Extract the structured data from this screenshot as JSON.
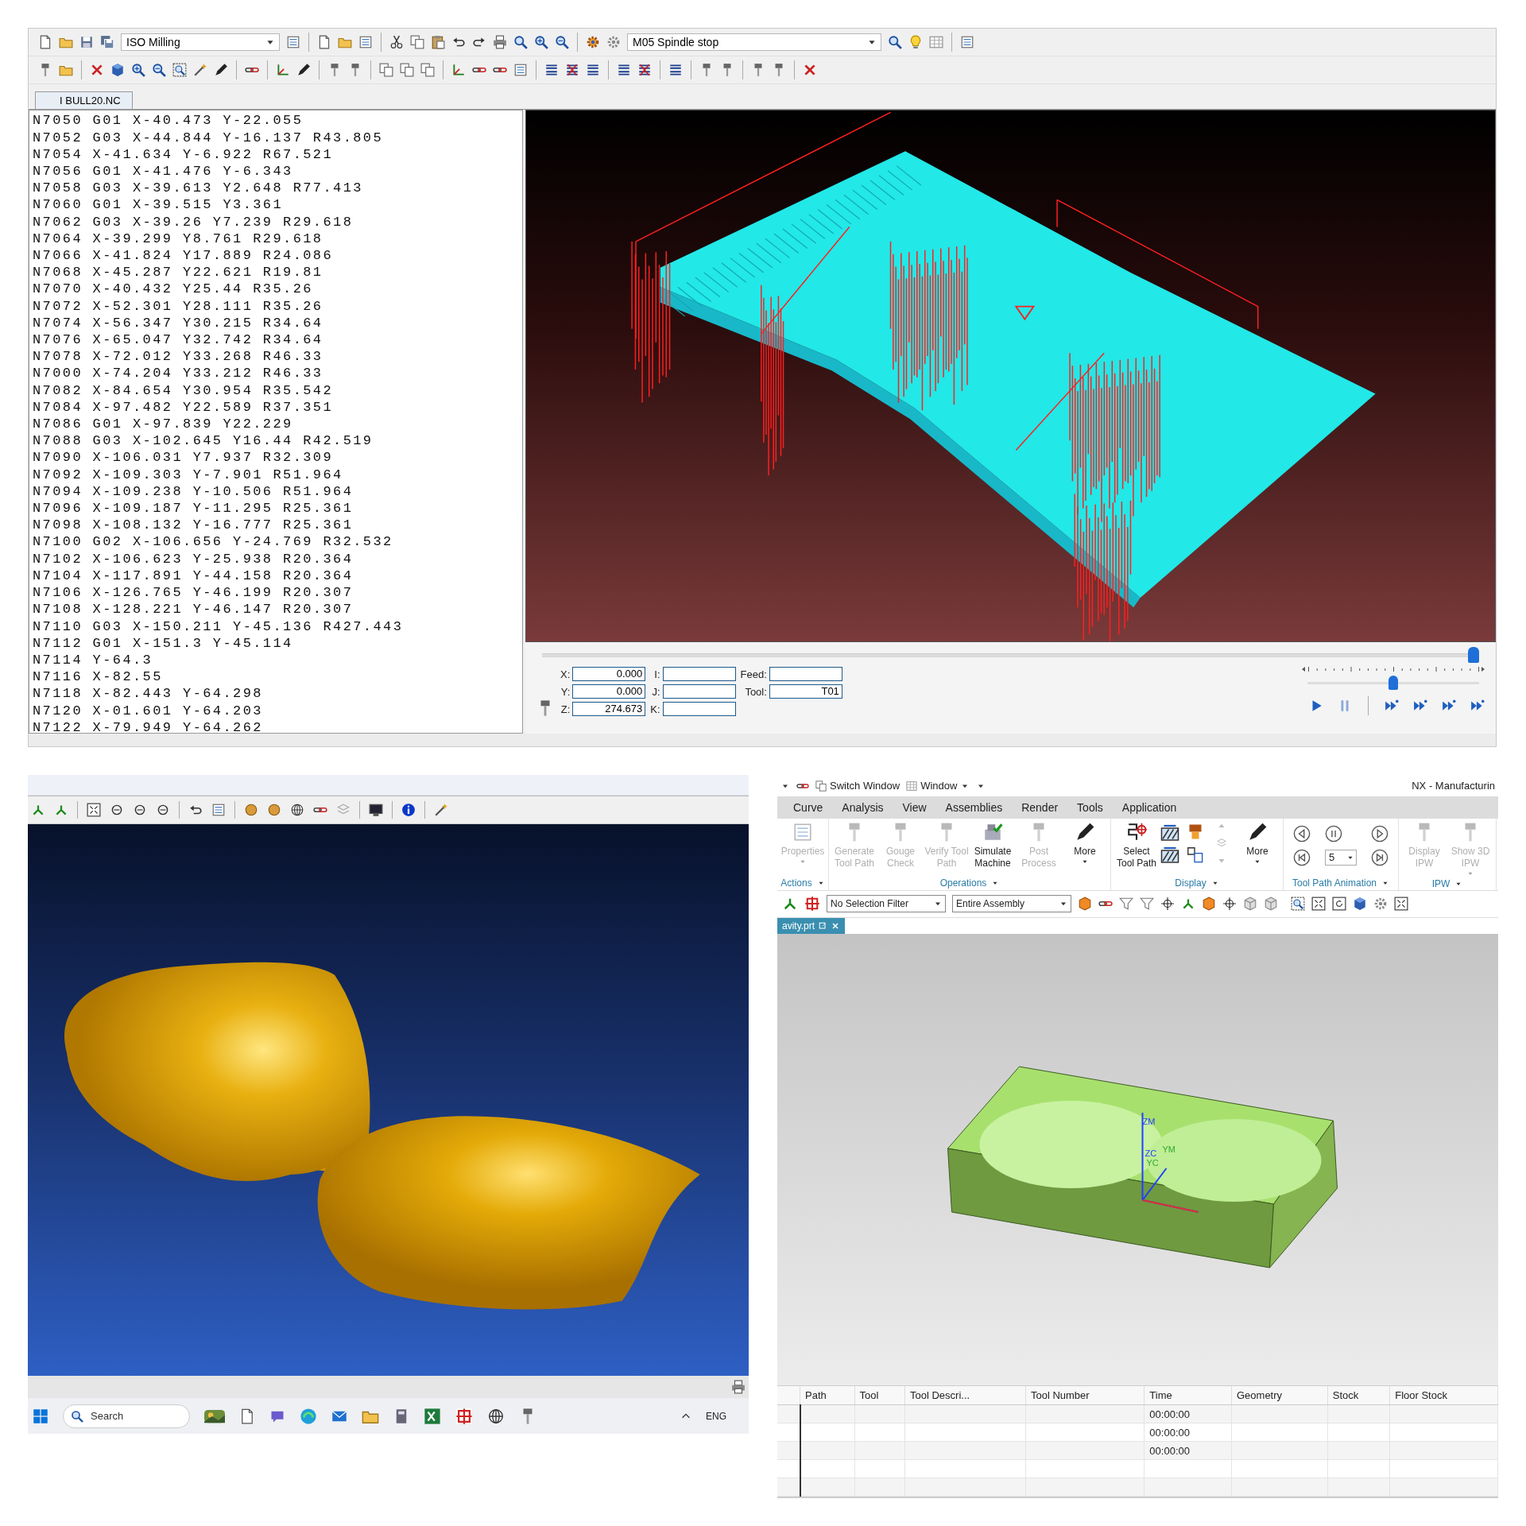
{
  "cam_editor": {
    "toolbar": {
      "machine_type": "ISO Milling",
      "spindle_command": "M05 Spindle stop"
    },
    "file_tab": "I BULL20.NC",
    "code_lines": [
      "N7050 G01 X-40.473 Y-22.055",
      "N7052 G03 X-44.844 Y-16.137 R43.805",
      "N7054 X-41.634 Y-6.922 R67.521",
      "N7056 G01 X-41.476 Y-6.343",
      "N7058 G03 X-39.613 Y2.648 R77.413",
      "N7060 G01 X-39.515 Y3.361",
      "N7062 G03 X-39.26 Y7.239 R29.618",
      "N7064 X-39.299 Y8.761 R29.618",
      "N7066 X-41.824 Y17.889 R24.086",
      "N7068 X-45.287 Y22.621 R19.81",
      "N7070 X-40.432 Y25.44 R35.26",
      "N7072 X-52.301 Y28.111 R35.26",
      "N7074 X-56.347 Y30.215 R34.64",
      "N7076 X-65.047 Y32.742 R34.64",
      "N7078 X-72.012 Y33.268 R46.33",
      "N7000 X-74.204 Y33.212 R46.33",
      "N7082 X-84.654 Y30.954 R35.542",
      "N7084 X-97.482 Y22.589 R37.351",
      "N7086 G01 X-97.839 Y22.229",
      "N7088 G03 X-102.645 Y16.44 R42.519",
      "N7090 X-106.031 Y7.937 R32.309",
      "N7092 X-109.303 Y-7.901 R51.964",
      "N7094 X-109.238 Y-10.506 R51.964",
      "N7096 X-109.187 Y-11.295 R25.361",
      "N7098 X-108.132 Y-16.777 R25.361",
      "N7100 G02 X-106.656 Y-24.769 R32.532",
      "N7102 X-106.623 Y-25.938 R20.364",
      "N7104 X-117.891 Y-44.158 R20.364",
      "N7106 X-126.765 Y-46.199 R20.307",
      "N7108 X-128.221 Y-46.147 R20.307",
      "N7110 G03 X-150.211 Y-45.136 R427.443",
      "N7112 G01 X-151.3 Y-45.114",
      "N7114 Y-64.3",
      "N7116 X-82.55",
      "N7118 X-82.443 Y-64.298",
      "N7120 X-01.601 Y-64.203",
      "N7122 X-79.949 Y-64.262"
    ],
    "readout": [
      {
        "label": "X:",
        "value": "0.000"
      },
      {
        "label": "Y:",
        "value": "0.000"
      },
      {
        "label": "Z:",
        "value": "274.673"
      },
      {
        "label": "I:"
      },
      {
        "label": "J:"
      },
      {
        "label": "K:"
      },
      {
        "label": "Feed:"
      },
      {
        "label": "Tool:",
        "value": "T01"
      }
    ],
    "playback": {
      "position": {
        "level": 1.0
      },
      "speed": {
        "level": 0.5
      }
    }
  },
  "mesh_viewer": {
    "taskbar": {
      "search": {
        "placeholder": "Search"
      },
      "language": "ENG"
    }
  },
  "nx": {
    "quick_access": [
      "Switch Window",
      "Window"
    ],
    "title": "NX - Manufacturin",
    "menu": [
      {
        "label": "Curve",
        "selected": false
      },
      {
        "label": "Analysis",
        "selected": false
      },
      {
        "label": "View",
        "selected": false
      },
      {
        "label": "Assemblies",
        "selected": false
      },
      {
        "label": "Render",
        "selected": false
      },
      {
        "label": "Tools",
        "selected": false
      },
      {
        "label": "Application",
        "selected": false
      }
    ],
    "ribbon_groups": [
      {
        "label": "Actions",
        "items": [
          {
            "kind": "button",
            "label": "Properties",
            "disabled": true,
            "menu": true
          }
        ]
      },
      {
        "label": "Operations",
        "items": [
          {
            "kind": "button",
            "label": "Generate Tool Path",
            "disabled": true,
            "menu": false
          },
          {
            "kind": "button",
            "label": "Gouge Check",
            "disabled": true,
            "menu": false
          },
          {
            "kind": "button",
            "label": "Verify Tool Path",
            "disabled": true,
            "menu": false
          },
          {
            "kind": "button",
            "label": "Simulate Machine",
            "disabled": false,
            "menu": false
          },
          {
            "kind": "button",
            "label": "Post Process",
            "disabled": true,
            "menu": false
          },
          {
            "kind": "button",
            "label": "More",
            "disabled": false,
            "menu": true
          }
        ]
      },
      {
        "label": "Display",
        "items": [
          {
            "kind": "button",
            "label": "Select Tool Path",
            "disabled": false,
            "menu": false
          },
          {
            "kind": "display-icons"
          },
          {
            "kind": "button",
            "label": "More",
            "disabled": false,
            "menu": true
          }
        ]
      },
      {
        "label": "Tool Path Animation",
        "items": [
          {
            "kind": "animation",
            "step": "5"
          }
        ]
      },
      {
        "label": "IPW",
        "items": [
          {
            "kind": "button",
            "label": "Display IPW",
            "disabled": true,
            "menu": false
          },
          {
            "kind": "button",
            "label": "Show 3D IPW",
            "disabled": true,
            "menu": true
          }
        ]
      }
    ],
    "filters": [
      "No Selection Filter",
      "Entire Assembly"
    ],
    "file_tab": "avity.prt",
    "axis_labels": [
      "ZM",
      "ZC",
      "YM",
      "YC"
    ],
    "table": {
      "columns": [
        "Path",
        "Tool",
        "Tool Descri...",
        "Tool Number",
        "Time",
        "Geometry",
        "Stock",
        "Floor Stock"
      ],
      "rows": [
        {
          "time": "00:00:00"
        },
        {
          "time": "00:00:00"
        },
        {
          "time": "00:00:00"
        }
      ]
    }
  }
}
